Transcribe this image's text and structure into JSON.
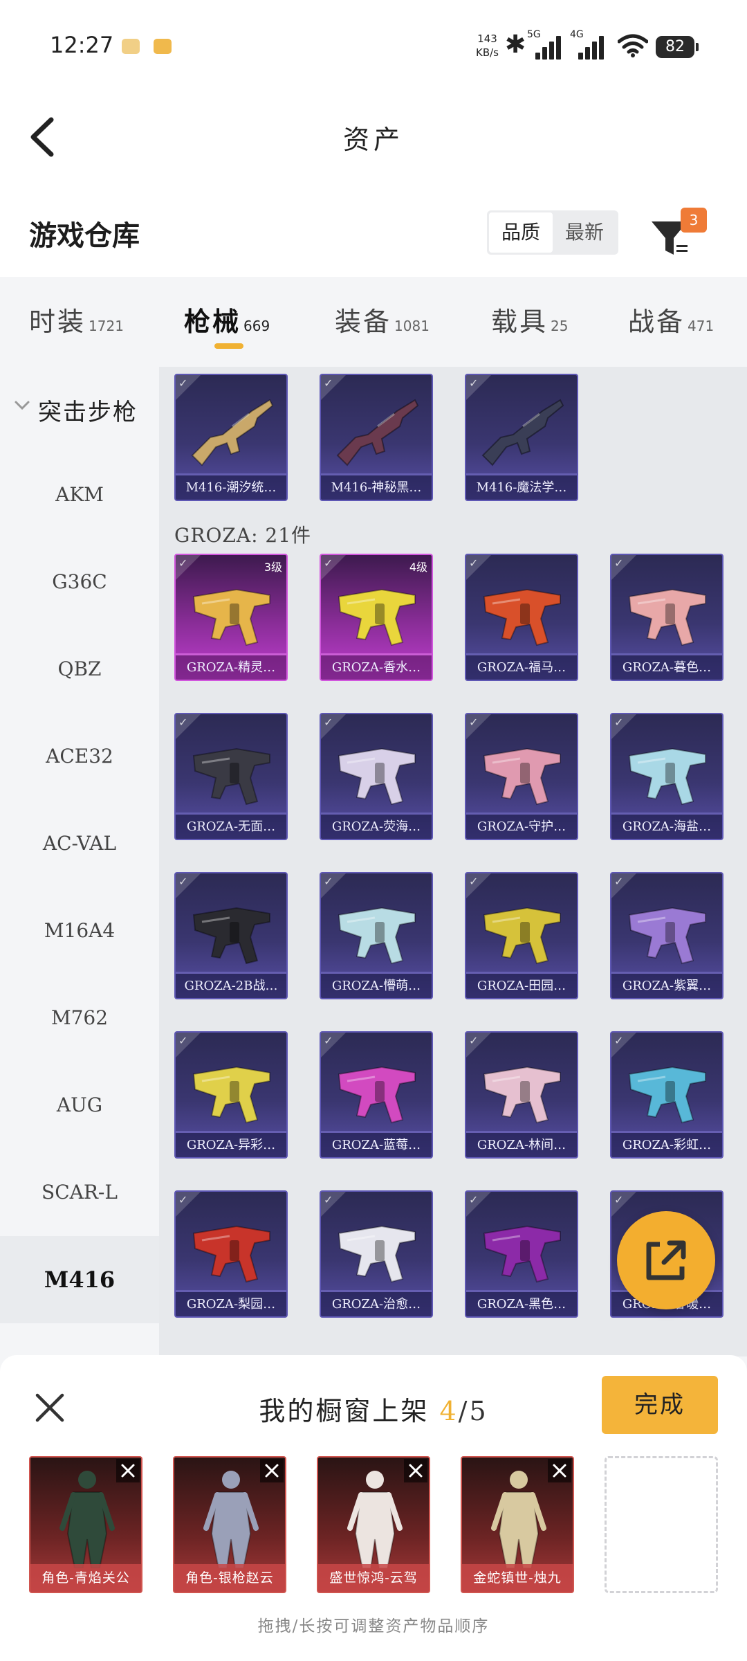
{
  "status_bar": {
    "time": "12:27",
    "net_speed_value": "143",
    "net_speed_unit": "KB/s",
    "signal_1_label": "5G",
    "signal_2_label": "4G",
    "battery": "82"
  },
  "header": {
    "title": "资产"
  },
  "warehouse": {
    "title": "游戏仓库",
    "sort_options": [
      "品质",
      "最新"
    ],
    "filter_count": "3"
  },
  "tabs": [
    {
      "label": "时装",
      "count": "1721"
    },
    {
      "label": "枪械",
      "count": "669"
    },
    {
      "label": "装备",
      "count": "1081"
    },
    {
      "label": "载具",
      "count": "25"
    },
    {
      "label": "战备",
      "count": "471"
    }
  ],
  "sidebar": {
    "group": "突击步枪",
    "items": [
      "AKM",
      "G36C",
      "QBZ",
      "ACE32",
      "AC-VAL",
      "M16A4",
      "M762",
      "AUG",
      "SCAR-L",
      "M416"
    ],
    "active": "M416"
  },
  "content": {
    "m416_items": [
      "M416-潮汐统…",
      "M416-神秘黑…",
      "M416-魔法学…"
    ],
    "groza_label": "GROZA: 21件",
    "groza_items": [
      {
        "name": "GROZA-精灵…",
        "level": "3级",
        "rarity": "pink",
        "color": "#e6b54a"
      },
      {
        "name": "GROZA-香水…",
        "level": "4级",
        "rarity": "pink",
        "color": "#e9d63c"
      },
      {
        "name": "GROZA-福马…",
        "level": "",
        "rarity": "purple",
        "color": "#d9502a"
      },
      {
        "name": "GROZA-暮色…",
        "level": "",
        "rarity": "purple",
        "color": "#e8a8a8"
      },
      {
        "name": "GROZA-无面…",
        "level": "",
        "rarity": "purple",
        "color": "#3a3a44"
      },
      {
        "name": "GROZA-荧海…",
        "level": "",
        "rarity": "purple",
        "color": "#d8d0e8"
      },
      {
        "name": "GROZA-守护…",
        "level": "",
        "rarity": "purple",
        "color": "#e09ab0"
      },
      {
        "name": "GROZA-海盐…",
        "level": "",
        "rarity": "purple",
        "color": "#a9d8e6"
      },
      {
        "name": "GROZA-2B战…",
        "level": "",
        "rarity": "purple",
        "color": "#2a2a30"
      },
      {
        "name": "GROZA-懵萌…",
        "level": "",
        "rarity": "purple",
        "color": "#b8dce4"
      },
      {
        "name": "GROZA-田园…",
        "level": "",
        "rarity": "purple",
        "color": "#d6c23a"
      },
      {
        "name": "GROZA-紫翼…",
        "level": "",
        "rarity": "purple",
        "color": "#9a7ad4"
      },
      {
        "name": "GROZA-异彩…",
        "level": "",
        "rarity": "purple",
        "color": "#e0d04a"
      },
      {
        "name": "GROZA-蓝莓…",
        "level": "",
        "rarity": "purple",
        "color": "#d24ac0"
      },
      {
        "name": "GROZA-林间…",
        "level": "",
        "rarity": "purple",
        "color": "#e6c0d0"
      },
      {
        "name": "GROZA-彩虹…",
        "level": "",
        "rarity": "purple",
        "color": "#58b8d8"
      },
      {
        "name": "GROZA-梨园…",
        "level": "",
        "rarity": "purple",
        "color": "#c8342a"
      },
      {
        "name": "GROZA-治愈…",
        "level": "",
        "rarity": "purple",
        "color": "#e6e6ee"
      },
      {
        "name": "GROZA-黑色…",
        "level": "",
        "rarity": "purple",
        "color": "#8c2aa8"
      },
      {
        "name": "GROZA-春暖…",
        "level": "",
        "rarity": "purple",
        "color": "#e8b070"
      }
    ]
  },
  "showcase": {
    "title": "我的橱窗上架",
    "current": "4",
    "separator": "/",
    "total": "5",
    "done_label": "完成",
    "slots": [
      "角色-青焰关公",
      "角色-银枪赵云",
      "盛世惊鸿-云驾",
      "金蛇镇世-烛九"
    ],
    "hint": "拖拽/长按可调整资产物品顺序"
  },
  "colors": {
    "accent": "#f0b132",
    "filter_badge": "#ef7b37",
    "done_button": "#f4b43a"
  }
}
